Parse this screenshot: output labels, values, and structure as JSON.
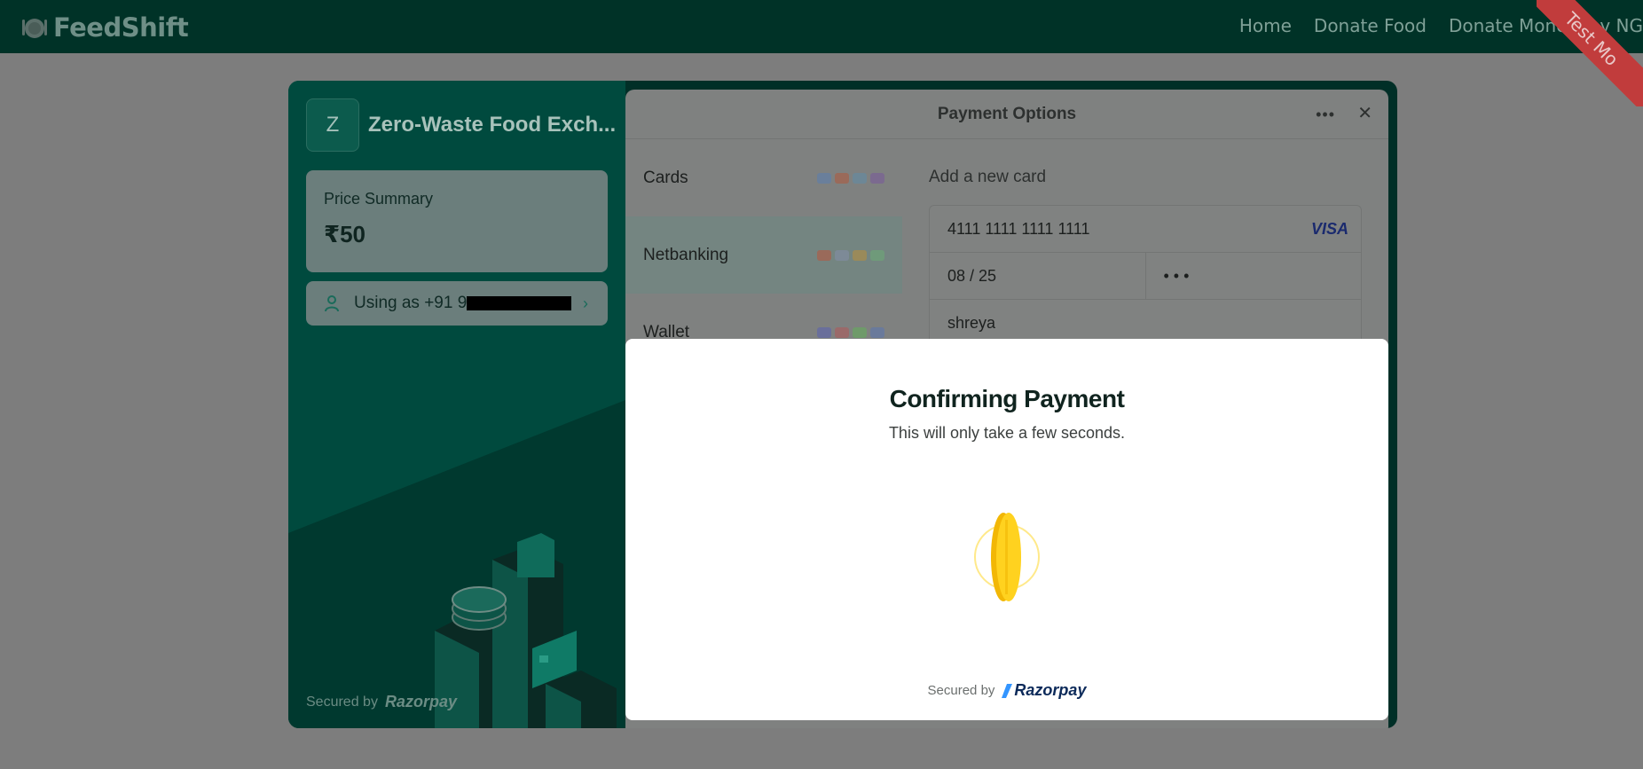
{
  "nav": {
    "brand": "FeedShift",
    "links": [
      "Home",
      "Donate Food",
      "Donate Money",
      "y NG"
    ],
    "ribbon": "Test Mo"
  },
  "checkout": {
    "merchant_initial": "Z",
    "merchant_name": "Zero-Waste Food Exch...",
    "price_label": "Price Summary",
    "price_value": "₹50",
    "user_prefix": "Using as +91 9",
    "secured_by": "Secured by",
    "razorpay": "Razorpay"
  },
  "payment": {
    "title": "Payment Options",
    "methods": [
      "Cards",
      "Netbanking",
      "Wallet"
    ],
    "form_title": "Add a new card",
    "card_number": "4111 1111 1111 1111",
    "card_brand": "VISA",
    "expiry": "08 / 25",
    "cvv": "• • •",
    "name": "shreya"
  },
  "modal": {
    "title": "Confirming Payment",
    "subtitle": "This will only take a few seconds.",
    "secured_by": "Secured by",
    "razorpay": "Razorpay"
  },
  "colors": {
    "nav_bg": "#003227",
    "checkout_bg": "#004a3e",
    "coin": "#ffd21f",
    "ribbon": "#c13c3c"
  }
}
